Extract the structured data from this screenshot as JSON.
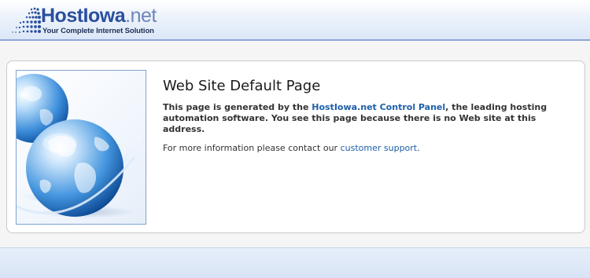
{
  "header": {
    "logo_main": "HostIowa",
    "logo_ext": ".net",
    "logo_tagline": "Your Complete Internet Solution"
  },
  "main": {
    "title": "Web Site Default Page",
    "desc_prefix": "This page is generated by the ",
    "desc_link": "HostIowa.net Control Panel",
    "desc_suffix": ", the leading hosting automation software. You see this page because there is no Web site at this address.",
    "more_prefix": "For more information please contact our ",
    "more_link": "customer support",
    "more_suffix": "."
  },
  "colors": {
    "brand": "#2a4f9e",
    "link": "#1c5faa",
    "header_border": "#8ea6d6"
  },
  "icons": {
    "logo_mark": "dot-fan-icon",
    "illustration": "globe-icon"
  }
}
